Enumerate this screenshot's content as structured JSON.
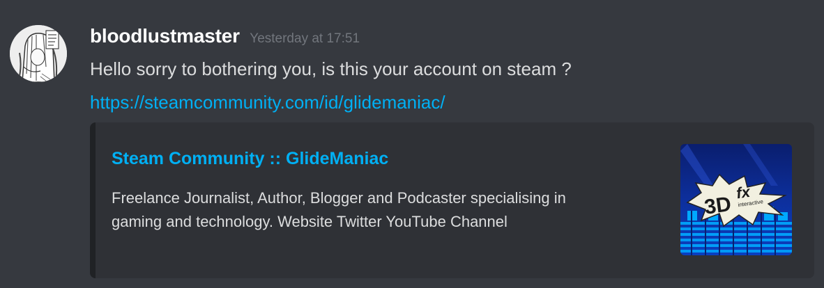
{
  "message": {
    "author": "bloodlustmaster",
    "timestamp": "Yesterday at 17:51",
    "text": "Hello sorry to bothering you, is this your account on steam ?",
    "link": "https://steamcommunity.com/id/glidemaniac/"
  },
  "embed": {
    "title": "Steam Community :: GlideManiac",
    "description_lines": [
      "Freelance Journalist, Author, Blogger and Podcaster specialising in",
      "gaming and technology. Website Twitter YouTube Channel"
    ],
    "thumbnail_text": "3Dfx",
    "thumbnail_subtext": "interactive"
  },
  "colors": {
    "background": "#36393f",
    "embed_background": "#2f3136",
    "embed_border": "#202225",
    "link": "#00b0f4",
    "username": "#ffffff",
    "timestamp": "#72767d",
    "text": "#dcddde"
  }
}
